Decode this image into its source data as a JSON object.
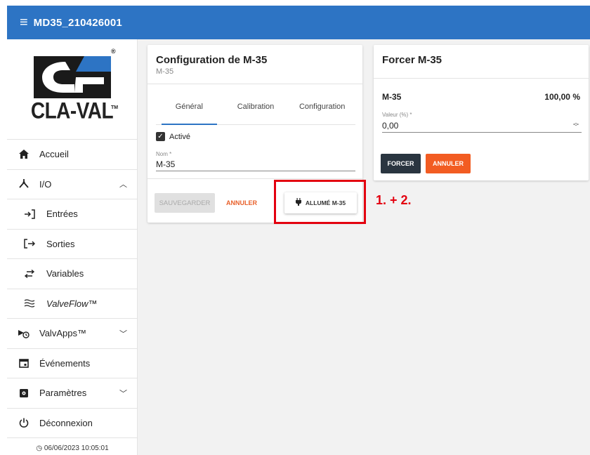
{
  "header": {
    "title": "MD35_210426001",
    "menu_icon": "hamburger-icon"
  },
  "logo": {
    "brand": "CLA-VAL",
    "registered": "®",
    "trademark": "TM"
  },
  "sidebar": {
    "items": [
      {
        "label": "Accueil",
        "icon": "home-icon"
      },
      {
        "label": "I/O",
        "icon": "io-icon"
      },
      {
        "label": "Entrées",
        "icon": "input-icon"
      },
      {
        "label": "Sorties",
        "icon": "output-icon"
      },
      {
        "label": "Variables",
        "icon": "swap-icon"
      },
      {
        "label": "ValveFlow™",
        "icon": "waves-icon"
      },
      {
        "label": "ValvApps™",
        "icon": "valve-icon"
      },
      {
        "label": "Événements",
        "icon": "calendar-icon"
      },
      {
        "label": "Paramètres",
        "icon": "settings-icon"
      },
      {
        "label": "Déconnexion",
        "icon": "power-icon"
      }
    ],
    "timestamp": "06/06/2023 10:05:01"
  },
  "config_card": {
    "title": "Configuration de M-35",
    "subtitle": "M-35",
    "tabs": [
      {
        "label": "Général",
        "active": true
      },
      {
        "label": "Calibration",
        "active": false
      },
      {
        "label": "Configuration",
        "active": false
      }
    ],
    "enabled_label": "Activé",
    "enabled": true,
    "name_label": "Nom *",
    "name_value": "M-35",
    "save_label": "SAUVEGARDER",
    "cancel_label": "ANNULER",
    "on_label": "ALLUMÉ M-35"
  },
  "force_card": {
    "title": "Forcer M-35",
    "name": "M-35",
    "percent": "100,00 %",
    "value_label": "Valeur (%) *",
    "value": "0,00",
    "force_label": "FORCER",
    "cancel_label": "ANNULER"
  },
  "annotation": {
    "text": "1. + 2.",
    "color": "#e3000f"
  },
  "colors": {
    "header": "#2d74c4",
    "accent_orange": "#f25c22",
    "dark_button": "#2a3540"
  }
}
